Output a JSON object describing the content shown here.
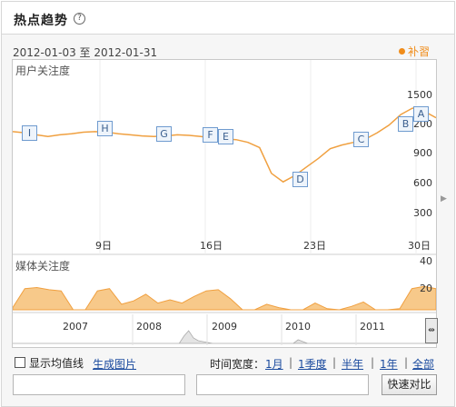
{
  "header": {
    "title": "热点趋势",
    "help_icon": "?"
  },
  "chart_header": {
    "date_range": "2012-01-03 至 2012-01-31",
    "legend_label": "补習"
  },
  "colors": {
    "line": "#f0a040",
    "area_fill": "#f7c98a",
    "event_box_border": "#6f9bcf",
    "link": "#1a4a9e"
  },
  "chart_data": [
    {
      "type": "line",
      "title": "",
      "ylabel": "用户关注度",
      "ylim": [
        0,
        1650
      ],
      "y_ticks": [
        "1500",
        "1200",
        "900",
        "600",
        "300"
      ],
      "x_ticks": [
        "9日",
        "16日",
        "23日",
        "30日"
      ],
      "series": [
        {
          "values": [
            1030,
            1020,
            1000,
            985,
            1000,
            1010,
            1025,
            1030,
            1025,
            1010,
            1000,
            990,
            985,
            990,
            1000,
            995,
            985,
            970,
            960,
            955,
            930,
            880,
            640,
            560,
            620,
            700,
            780,
            870,
            905,
            930,
            960,
            1020,
            1090,
            1190,
            1250,
            1220,
            1160
          ]
        }
      ],
      "events": [
        "I",
        "H",
        "G",
        "F",
        "E",
        "D",
        "C",
        "B",
        "A"
      ]
    },
    {
      "type": "area",
      "title": "",
      "ylabel": "媒体关注度",
      "ylim": [
        0,
        40
      ],
      "y_ticks": [
        "40",
        "20"
      ],
      "series": [
        {
          "values": [
            2,
            19,
            20,
            18,
            17,
            0,
            0,
            17,
            19,
            5,
            8,
            14,
            6,
            9,
            6,
            12,
            17,
            18,
            10,
            0,
            0,
            5,
            2,
            0,
            0,
            6,
            1,
            0,
            3,
            7,
            0,
            0,
            1,
            19,
            21,
            19
          ]
        }
      ]
    }
  ],
  "timeline": {
    "years": [
      "2007",
      "2008",
      "2009",
      "2010",
      "2011"
    ]
  },
  "controls": {
    "show_avg_label": "显示均值线",
    "generate_image_label": "生成图片",
    "time_span_label": "时间宽度：",
    "span_options": [
      "1月",
      "1季度",
      "半年",
      "1年",
      "全部"
    ],
    "compare_button": "快速对比"
  }
}
